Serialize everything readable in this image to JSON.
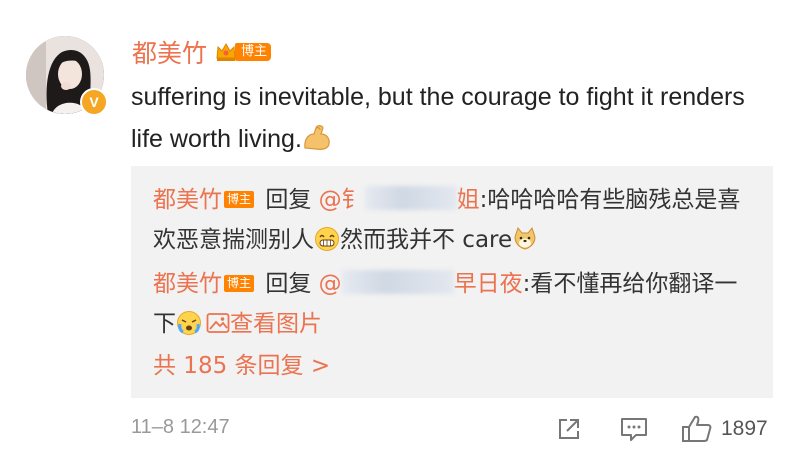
{
  "comment": {
    "author_name": "都美竹",
    "author_tag": "博主",
    "verified_badge": "V",
    "text": "suffering is inevitable,  but the courage to fight it renders life worth living.",
    "emoji": "flexed-biceps-emoji",
    "time": "11–8 12:47",
    "like_count": "1897"
  },
  "replies": [
    {
      "author": "都美竹",
      "tag": "博主",
      "reply_word": "回复",
      "mention_prefix": "@钅",
      "mention_suffix": "姐",
      "text": ":哈哈哈哈有些脑残总是喜欢恶意揣测别人",
      "text_after_emoji": "然而我并不 care"
    },
    {
      "author": "都美竹",
      "tag": "博主",
      "reply_word": "回复",
      "mention_prefix": "@",
      "mention_suffix": "早日夜",
      "text": ":看不懂再给你翻译一下",
      "image_link": "查看图片"
    }
  ],
  "total_replies": "共 185 条回复 >",
  "colors": {
    "name": "#eb7350",
    "tag_bg": "#ff8200",
    "reply_bg": "#f2f2f2",
    "time": "#999999"
  },
  "icons": {
    "share": "share-icon",
    "comment": "comment-icon",
    "like": "thumbs-up-icon"
  }
}
